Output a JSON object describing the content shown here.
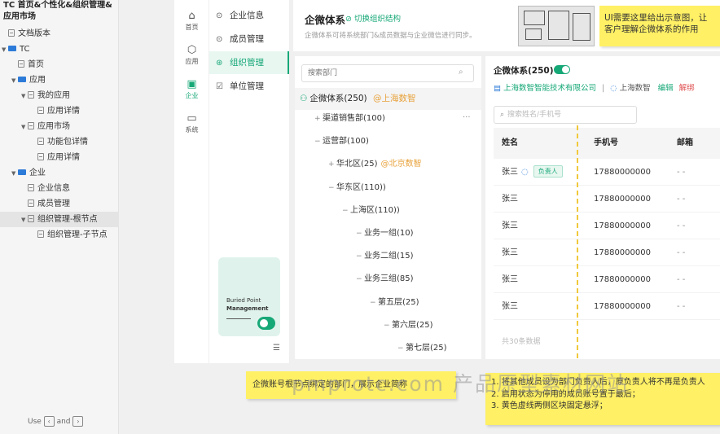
{
  "tree": {
    "project_title": "TC 首页&个性化&组织管理&应用市场",
    "items": [
      {
        "label": "文档版本",
        "type": "page",
        "level": 0
      },
      {
        "label": "TC",
        "type": "folder",
        "level": 0,
        "expanded": true
      },
      {
        "label": "首页",
        "type": "page",
        "level": 1
      },
      {
        "label": "应用",
        "type": "folder",
        "level": 1,
        "expanded": true
      },
      {
        "label": "我的应用",
        "type": "page",
        "level": 2,
        "expanded": true
      },
      {
        "label": "应用详情",
        "type": "page",
        "level": 3
      },
      {
        "label": "应用市场",
        "type": "page",
        "level": 2,
        "expanded": true
      },
      {
        "label": "功能包详情",
        "type": "page",
        "level": 3
      },
      {
        "label": "应用详情",
        "type": "page",
        "level": 3
      },
      {
        "label": "企业",
        "type": "folder",
        "level": 1,
        "expanded": true
      },
      {
        "label": "企业信息",
        "type": "page",
        "level": 2
      },
      {
        "label": "成员管理",
        "type": "page",
        "level": 2
      },
      {
        "label": "组织管理-根节点",
        "type": "page",
        "level": 2,
        "expanded": true,
        "selected": true
      },
      {
        "label": "组织管理-子节点",
        "type": "page",
        "level": 3
      }
    ],
    "hint": {
      "use": "Use",
      "and": "and",
      "key_left": "‹",
      "key_right": "›"
    }
  },
  "icon_nav": [
    {
      "label": "首页",
      "icon": "home-icon",
      "glyph": "⌂"
    },
    {
      "label": "应用",
      "icon": "app-cube-icon",
      "glyph": "⬡"
    },
    {
      "label": "企业",
      "icon": "enterprise-icon",
      "glyph": "▣",
      "active": true
    },
    {
      "label": "系统",
      "icon": "system-icon",
      "glyph": "▭"
    }
  ],
  "sub_nav": [
    {
      "label": "企业信息",
      "icon": "info-icon",
      "glyph": "⊙"
    },
    {
      "label": "成员管理",
      "icon": "member-icon",
      "glyph": "⊙"
    },
    {
      "label": "组织管理",
      "icon": "org-icon",
      "glyph": "⊛",
      "active": true
    },
    {
      "label": "单位管理",
      "icon": "unit-icon",
      "glyph": "☑"
    }
  ],
  "promo": {
    "line1": "Buried Point",
    "line2": "Management"
  },
  "collapse_glyph": "☰",
  "header": {
    "title": "企微体系",
    "switch_label": "切换组织结构",
    "description": "企微体系可将系统部门&成员数据与企业微信进行同步。"
  },
  "dept": {
    "search_placeholder": "搜索部门",
    "root": {
      "label": "企微体系(250)",
      "tag": "@上海数智"
    },
    "more": "···",
    "nodes": [
      {
        "label": "渠道销售部(100)",
        "toggle": "+",
        "indent": 0
      },
      {
        "label": "运营部(100)",
        "toggle": "−",
        "indent": 0
      },
      {
        "label": "华北区(25)",
        "toggle": "+",
        "indent": 1,
        "tag": "@北京数智"
      },
      {
        "label": "华东区(110))",
        "toggle": "−",
        "indent": 1
      },
      {
        "label": "上海区(110))",
        "toggle": "−",
        "indent": 2
      },
      {
        "label": "业务一组(10)",
        "toggle": "−",
        "indent": 3
      },
      {
        "label": "业务二组(15)",
        "toggle": "−",
        "indent": 3
      },
      {
        "label": "业务三组(85)",
        "toggle": "−",
        "indent": 3
      },
      {
        "label": "第五层(25)",
        "toggle": "−",
        "indent": 4
      },
      {
        "label": "第六层(25)",
        "toggle": "−",
        "indent": 5
      },
      {
        "label": "第七层(25)",
        "toggle": "−",
        "indent": 6
      }
    ]
  },
  "members": {
    "title": "企微体系(250)",
    "company": "上海数智智能技术有限公司",
    "bound_org": "上海数智",
    "edit": "编辑",
    "unbind": "解绑",
    "search_placeholder": "搜索姓名/手机号",
    "columns": [
      "姓名",
      "手机号",
      "邮箱"
    ],
    "rows": [
      {
        "name": "张三",
        "phone": "17880000000",
        "email": "- -",
        "wecom": true,
        "badge": "负责人"
      },
      {
        "name": "张三",
        "phone": "17880000000",
        "email": "- -"
      },
      {
        "name": "张三",
        "phone": "17880000000",
        "email": "- -"
      },
      {
        "name": "张三",
        "phone": "17880000000",
        "email": "- -"
      },
      {
        "name": "张三",
        "phone": "17880000000",
        "email": "- -"
      },
      {
        "name": "张三",
        "phone": "17880000000",
        "email": "- -"
      }
    ],
    "total": "共30条数据"
  },
  "notes": {
    "note1": "UI需要这里给出示意图，让客户理解企微体系的作用",
    "note2": "企微账号根节点绑定的部门，展示企业简称",
    "note3_lines": [
      "1. 将其他成员设为部门负责人后，原负责人将不再是负责人",
      "2. 启用状态为停用的成员账号置于最后；",
      "3. 黄色虚线两侧区块固定悬浮；"
    ]
  },
  "watermark": "pmprotc.com 产品原型素材网站",
  "colors": {
    "accent": "#17a878",
    "note": "#fff065",
    "link_blue": "#2d7bd8",
    "danger": "#e05050",
    "tag_orange": "#e8a23c"
  }
}
